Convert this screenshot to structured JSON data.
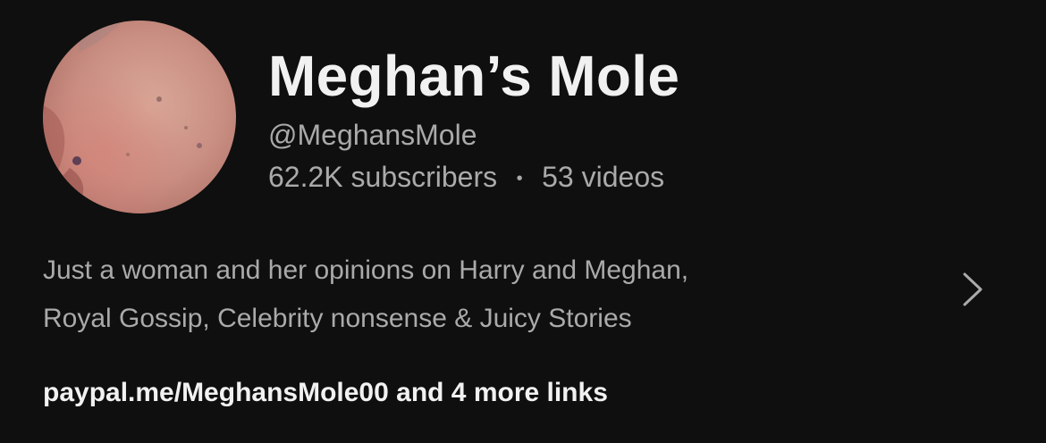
{
  "channel": {
    "name": "Meghan’s Mole",
    "handle": "@MeghansMole",
    "subscribers": "62.2K subscribers",
    "separator": "•",
    "videos": "53 videos"
  },
  "description": {
    "line1": "Just a woman and her opinions on Harry and Meghan,",
    "line2": "Royal Gossip, Celebrity nonsense & Juicy Stories"
  },
  "links": {
    "primary": "paypal.me/MeghansMole00",
    "more": " and 4 more links"
  },
  "icons": {
    "more_description": "chevron-right-icon"
  },
  "colors": {
    "background": "#0f0f0f",
    "primary_text": "#f1f1f1",
    "secondary_text": "#aaaaaa"
  }
}
